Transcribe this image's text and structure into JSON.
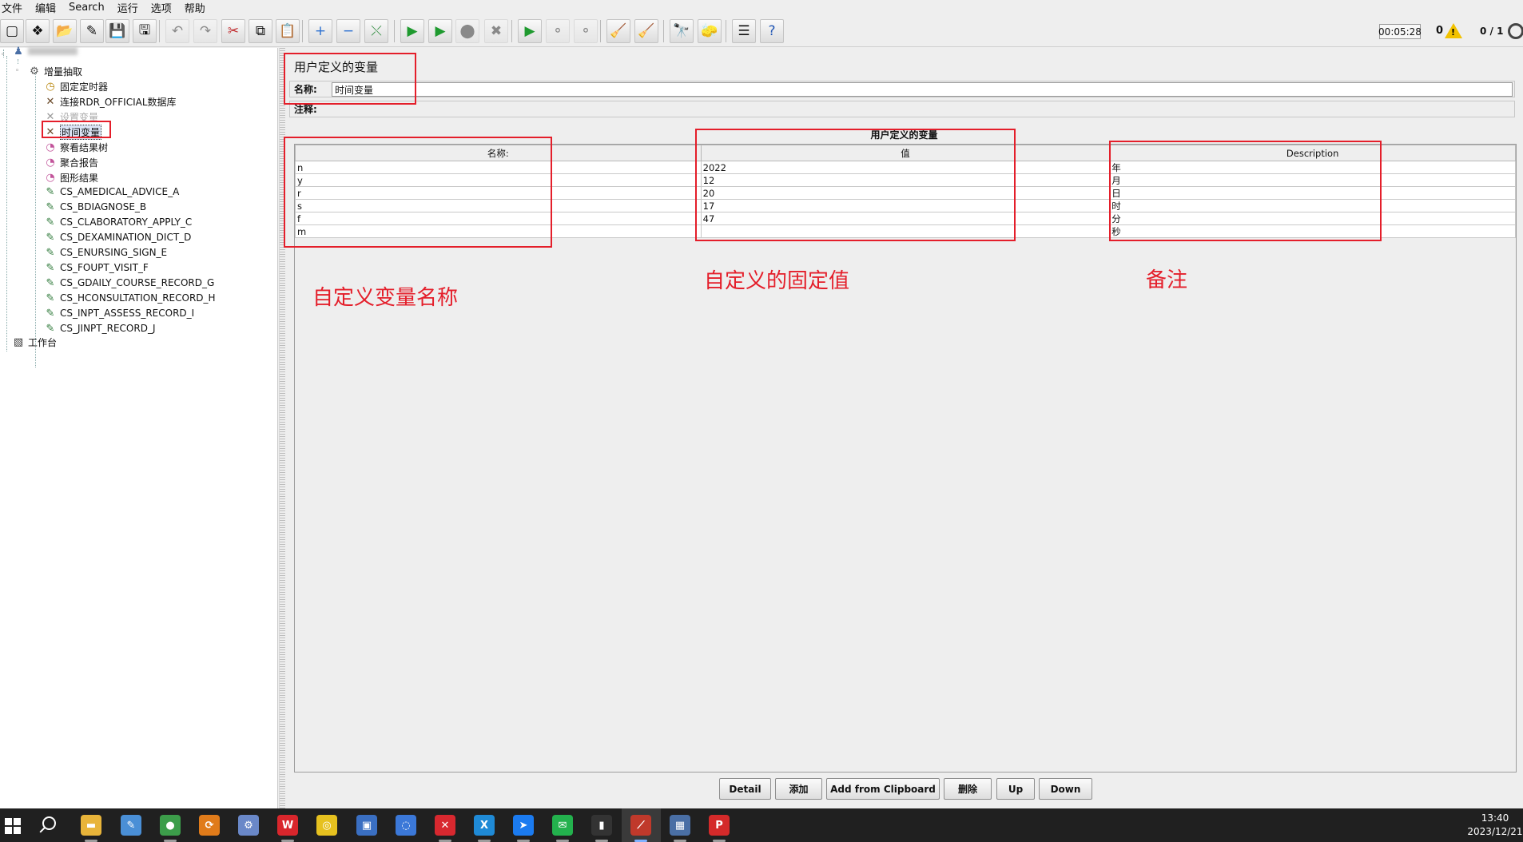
{
  "menu": [
    "文件",
    "编辑",
    "Search",
    "运行",
    "选项",
    "帮助"
  ],
  "toolbar": {
    "timer": "00:05:28",
    "warning_count": "0",
    "threads": "0 / 1",
    "buttons": [
      {
        "name": "new-icon",
        "glyph": "▢"
      },
      {
        "name": "templates-icon",
        "glyph": "❖"
      },
      {
        "name": "open-icon",
        "glyph": "📂"
      },
      {
        "name": "close-icon",
        "glyph": "✎"
      },
      {
        "name": "save-icon",
        "glyph": "💾"
      },
      {
        "name": "save-as-icon",
        "glyph": "🖫"
      },
      {
        "name": "undo-icon",
        "glyph": "↶"
      },
      {
        "name": "redo-icon",
        "glyph": "↷"
      },
      {
        "name": "cut-icon",
        "glyph": "✂"
      },
      {
        "name": "copy-icon",
        "glyph": "⧉"
      },
      {
        "name": "paste-icon",
        "glyph": "📋"
      },
      {
        "name": "expand-icon",
        "glyph": "+"
      },
      {
        "name": "collapse-icon",
        "glyph": "−"
      },
      {
        "name": "toggle-icon",
        "glyph": "⤬"
      },
      {
        "name": "start-icon",
        "glyph": "▶"
      },
      {
        "name": "start-no-pause-icon",
        "glyph": "▶"
      },
      {
        "name": "stop-icon",
        "glyph": "⬤"
      },
      {
        "name": "shutdown-icon",
        "glyph": "✖"
      },
      {
        "name": "remote-start-icon",
        "glyph": "▶"
      },
      {
        "name": "remote-stop-icon",
        "glyph": "⚬"
      },
      {
        "name": "remote-shutdown-icon",
        "glyph": "⚬"
      },
      {
        "name": "clear-icon",
        "glyph": "🧹"
      },
      {
        "name": "clear-all-icon",
        "glyph": "🧹"
      },
      {
        "name": "search-icon",
        "glyph": "🔭"
      },
      {
        "name": "reset-search-icon",
        "glyph": "🧽"
      },
      {
        "name": "function-helper-icon",
        "glyph": "☰"
      },
      {
        "name": "help-icon",
        "glyph": "?"
      }
    ]
  },
  "tree": {
    "root_label": "",
    "group_label": "增量抽取",
    "items": [
      {
        "label": "固定定时器",
        "icon": "timer-icon",
        "glyph": "◷"
      },
      {
        "label": "连接RDR_OFFICIAL数据库",
        "icon": "jdbc-config-icon",
        "glyph": "✕"
      },
      {
        "label": "设置变量",
        "icon": "config-element-icon",
        "glyph": "✕"
      },
      {
        "label": "时间变量",
        "icon": "user-variables-icon",
        "glyph": "✕"
      },
      {
        "label": "察看结果树",
        "icon": "listener-icon",
        "glyph": "◔"
      },
      {
        "label": "聚合报告",
        "icon": "listener-icon",
        "glyph": "◔"
      },
      {
        "label": "图形结果",
        "icon": "listener-icon",
        "glyph": "◔"
      },
      {
        "label": "CS_AMEDICAL_ADVICE_A",
        "icon": "jdbc-sampler-icon",
        "glyph": "✎"
      },
      {
        "label": "CS_BDIAGNOSE_B",
        "icon": "jdbc-sampler-icon",
        "glyph": "✎"
      },
      {
        "label": "CS_CLABORATORY_APPLY_C",
        "icon": "jdbc-sampler-icon",
        "glyph": "✎"
      },
      {
        "label": "CS_DEXAMINATION_DICT_D",
        "icon": "jdbc-sampler-icon",
        "glyph": "✎"
      },
      {
        "label": "CS_ENURSING_SIGN_E",
        "icon": "jdbc-sampler-icon",
        "glyph": "✎"
      },
      {
        "label": "CS_FOUPT_VISIT_F",
        "icon": "jdbc-sampler-icon",
        "glyph": "✎"
      },
      {
        "label": "CS_GDAILY_COURSE_RECORD_G",
        "icon": "jdbc-sampler-icon",
        "glyph": "✎"
      },
      {
        "label": "CS_HCONSULTATION_RECORD_H",
        "icon": "jdbc-sampler-icon",
        "glyph": "✎"
      },
      {
        "label": "CS_INPT_ASSESS_RECORD_I",
        "icon": "jdbc-sampler-icon",
        "glyph": "✎"
      },
      {
        "label": "CS_JINPT_RECORD_J",
        "icon": "jdbc-sampler-icon",
        "glyph": "✎"
      }
    ],
    "workbench_label": "工作台"
  },
  "panel": {
    "title": "用户定义的变量",
    "name_label": "名称:",
    "name_value": "时间变量",
    "comment_label": "注释:",
    "comment_value": "",
    "table_title": "用户定义的变量",
    "columns": [
      "名称:",
      "值",
      "Description"
    ],
    "rows": [
      [
        "n",
        "2022",
        "年"
      ],
      [
        "y",
        "12",
        "月"
      ],
      [
        "r",
        "20",
        "日"
      ],
      [
        "s",
        "17",
        "时"
      ],
      [
        "f",
        "47",
        "分"
      ],
      [
        "m",
        "",
        "秒"
      ]
    ],
    "buttons": [
      "Detail",
      "添加",
      "Add from Clipboard",
      "删除",
      "Up",
      "Down"
    ]
  },
  "annotations": {
    "name_note": "自定义变量名称",
    "value_note": "自定义的固定值",
    "desc_note": "备注"
  },
  "taskbar": {
    "time": "13:40",
    "date": "2023/12/21",
    "apps": [
      {
        "name": "file-explorer-icon",
        "glyph": "▬",
        "color": "#e8b43a"
      },
      {
        "name": "notes-app-icon",
        "glyph": "✎",
        "color": "#4a8fd6"
      },
      {
        "name": "chrome-icon",
        "glyph": "●",
        "color": "#3c9d4a"
      },
      {
        "name": "sync-app-icon",
        "glyph": "⟳",
        "color": "#e07b1a"
      },
      {
        "name": "dev-tool-icon",
        "glyph": "⚙",
        "color": "#6a88c8"
      },
      {
        "name": "wps-icon",
        "glyph": "W",
        "color": "#d9262c"
      },
      {
        "name": "compass-app-icon",
        "glyph": "◎",
        "color": "#e6c11f"
      },
      {
        "name": "remote-desktop-icon",
        "glyph": "▣",
        "color": "#3a6fc2"
      },
      {
        "name": "browser-app-icon",
        "glyph": "◌",
        "color": "#3b78d8"
      },
      {
        "name": "xmind-icon",
        "glyph": "✕",
        "color": "#d8282f"
      },
      {
        "name": "xshell-icon",
        "glyph": "X",
        "color": "#1f8ad6"
      },
      {
        "name": "feishu-icon",
        "glyph": "➤",
        "color": "#1b7bf0"
      },
      {
        "name": "wechat-icon",
        "glyph": "✉",
        "color": "#23b14d"
      },
      {
        "name": "terminal-icon",
        "glyph": "▮",
        "color": "#333333"
      },
      {
        "name": "jmeter-icon",
        "glyph": "⟋",
        "color": "#c0392b"
      },
      {
        "name": "calculator-icon",
        "glyph": "▦",
        "color": "#4a6fa5"
      },
      {
        "name": "pdf-app-icon",
        "glyph": "P",
        "color": "#d42a2a"
      }
    ]
  }
}
